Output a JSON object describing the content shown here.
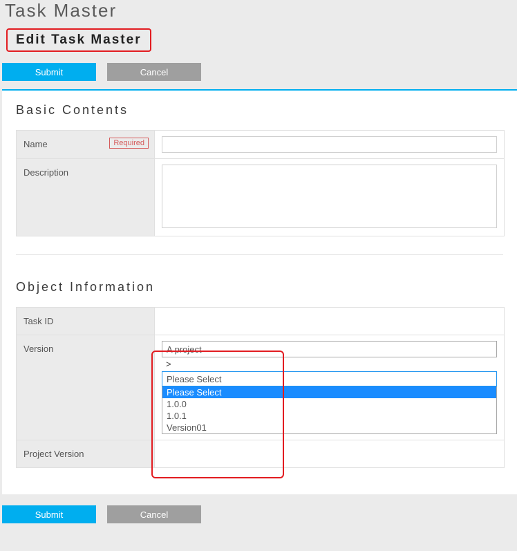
{
  "header": {
    "page_title": "Task Master",
    "subtitle": "Edit Task Master"
  },
  "buttons": {
    "submit": "Submit",
    "cancel": "Cancel"
  },
  "sections": {
    "basic": {
      "title": "Basic Contents",
      "fields": {
        "name_label": "Name",
        "name_required": "Required",
        "name_value": "",
        "desc_label": "Description",
        "desc_value": ""
      }
    },
    "object": {
      "title": "Object Information",
      "fields": {
        "taskid_label": "Task ID",
        "taskid_value": "",
        "version_label": "Version",
        "version_first_value": "A project",
        "version_gt": ">",
        "version_select_closed": "Please Select",
        "version_options": [
          "Please Select",
          "1.0.0",
          "1.0.1",
          "Version01"
        ],
        "projver_label": "Project Version"
      }
    }
  }
}
